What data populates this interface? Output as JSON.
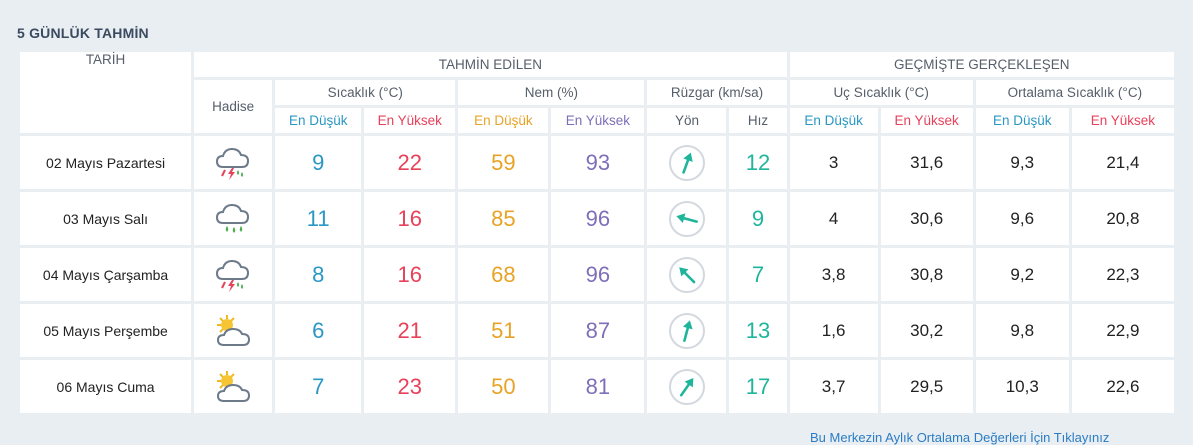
{
  "section_title": "5 GÜNLÜK TAHMİN",
  "headers": {
    "date": "TARİH",
    "forecast_group": "TAHMİN EDİLEN",
    "past_group": "GEÇMİŞTE GERÇEKLEŞEN",
    "event": "Hadise",
    "temperature": "Sıcaklık (°C)",
    "humidity": "Nem (%)",
    "wind": "Rüzgar (km/sa)",
    "extreme_temp": "Uç Sıcaklık (°C)",
    "avg_temp": "Ortalama Sıcaklık (°C)",
    "low": "En Düşük",
    "high": "En Yüksek",
    "direction": "Yön",
    "speed": "Hız"
  },
  "days": [
    {
      "date": "02 Mayıs Pazartesi",
      "icon": "thunder-rain-cloud-icon",
      "temp_low": "9",
      "temp_high": "22",
      "hum_low": "59",
      "hum_high": "93",
      "wind_dir_deg": 200,
      "wind_speed": "12",
      "ext_low": "3",
      "ext_high": "31,6",
      "avg_low": "9,3",
      "avg_high": "21,4"
    },
    {
      "date": "03 Mayıs Salı",
      "icon": "rain-cloud-icon",
      "temp_low": "11",
      "temp_high": "16",
      "hum_low": "85",
      "hum_high": "96",
      "wind_dir_deg": 105,
      "wind_speed": "9",
      "ext_low": "4",
      "ext_high": "30,6",
      "avg_low": "9,6",
      "avg_high": "20,8"
    },
    {
      "date": "04 Mayıs Çarşamba",
      "icon": "thunder-rain-cloud-icon",
      "temp_low": "8",
      "temp_high": "16",
      "hum_low": "68",
      "hum_high": "96",
      "wind_dir_deg": 135,
      "wind_speed": "7",
      "ext_low": "3,8",
      "ext_high": "30,8",
      "avg_low": "9,2",
      "avg_high": "22,3"
    },
    {
      "date": "05 Mayıs Perşembe",
      "icon": "partly-cloudy-icon",
      "temp_low": "6",
      "temp_high": "21",
      "hum_low": "51",
      "hum_high": "87",
      "wind_dir_deg": 195,
      "wind_speed": "13",
      "ext_low": "1,6",
      "ext_high": "30,2",
      "avg_low": "9,8",
      "avg_high": "22,9"
    },
    {
      "date": "06 Mayıs Cuma",
      "icon": "partly-cloudy-icon",
      "temp_low": "7",
      "temp_high": "23",
      "hum_low": "50",
      "hum_high": "81",
      "wind_dir_deg": 215,
      "wind_speed": "17",
      "ext_low": "3,7",
      "ext_high": "29,5",
      "avg_low": "10,3",
      "avg_high": "22,6"
    }
  ],
  "footer_link": "Bu Merkezin Aylık Ortalama Değerleri İçin Tıklayınız",
  "colors": {
    "low": "#2a97c4",
    "high": "#e8415a",
    "hum_low": "#e8a326",
    "hum_high": "#7e6fb8",
    "wind": "#1fb59a"
  }
}
